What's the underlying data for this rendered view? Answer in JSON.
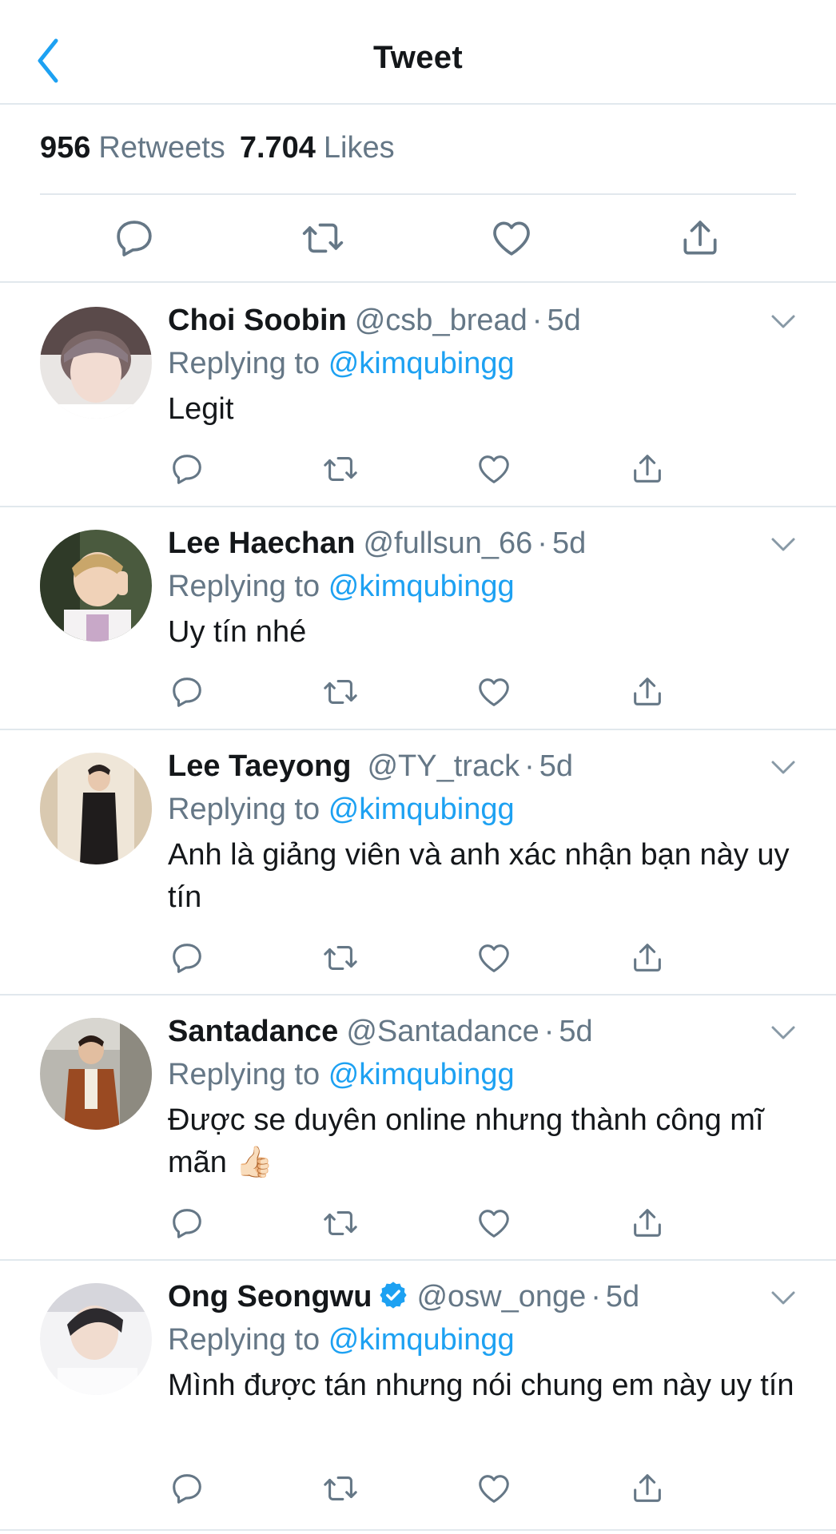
{
  "header": {
    "title": "Tweet",
    "back_icon": "chevron-left-icon"
  },
  "stats": {
    "retweets_count": "956",
    "retweets_label": "Retweets",
    "likes_count": "7.704",
    "likes_label": "Likes"
  },
  "colors": {
    "accent": "#1da1f2",
    "text": "#14171a",
    "secondary": "#657786",
    "divider": "#e1e8ed"
  },
  "action_icons": [
    "reply-icon",
    "retweet-icon",
    "like-icon",
    "share-icon"
  ],
  "replies": [
    {
      "name": "Choi Soobin",
      "handle": "@csb_bread",
      "time": "5d",
      "replying_label": "Replying to",
      "replying_to": "@kimqubingg",
      "text": "Legit",
      "verified": false
    },
    {
      "name": "Lee Haechan",
      "handle": "@fullsun_66",
      "time": "5d",
      "replying_label": "Replying to",
      "replying_to": "@kimqubingg",
      "text": "Uy tín nhé",
      "verified": false
    },
    {
      "name": "Lee Taeyong",
      "handle": "@TY_track",
      "time": "5d",
      "replying_label": "Replying to",
      "replying_to": "@kimqubingg",
      "text": "Anh là giảng viên và anh xác nhận bạn này uy tín",
      "verified": false
    },
    {
      "name": "Santadance",
      "handle": "@Santadance",
      "time": "5d",
      "replying_label": "Replying to",
      "replying_to": "@kimqubingg",
      "text": "Được se duyên online nhưng thành công mĩ mãn 👍🏻",
      "verified": false
    },
    {
      "name": "Ong Seongwu",
      "handle": "@osw_onge",
      "time": "5d",
      "replying_label": "Replying to",
      "replying_to": "@kimqubingg",
      "text": "Mình được tán nhưng nói chung em này uy tín",
      "verified": true
    }
  ]
}
